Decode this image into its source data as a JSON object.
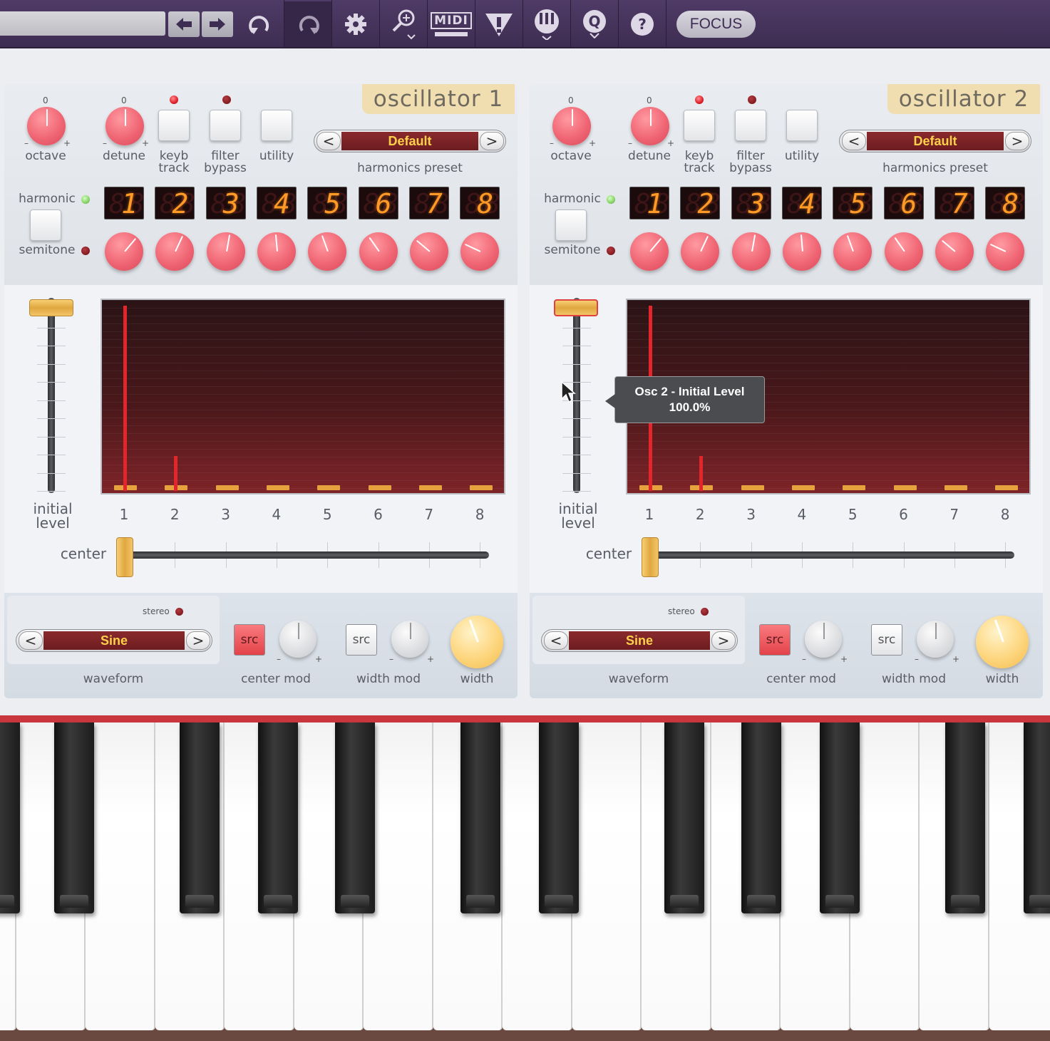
{
  "toolbar": {
    "icons": [
      "arrow-left-icon",
      "arrow-right-icon",
      "undo-icon",
      "redo-icon",
      "gear-icon",
      "zoom-icon",
      "midi-icon",
      "warning-icon",
      "keyboard-icon",
      "quantize-icon",
      "help-icon"
    ],
    "midi_label": "MIDI",
    "q_label": "Q",
    "help_label": "?",
    "focus_label": "FOCUS"
  },
  "osc1": {
    "title": "oscillator 1",
    "octave_label": "octave",
    "octave_zero": "0",
    "detune_label": "detune",
    "detune_zero": "0",
    "keybtrack_label": "keyb\ntrack",
    "filterbypass_label": "filter\nbypass",
    "utility_label": "utility",
    "preset_prev": "<",
    "preset_value": "Default",
    "preset_next": ">",
    "preset_label": "harmonics preset",
    "harmonic_label": "harmonic",
    "semitone_label": "semitone",
    "digits": [
      "1",
      "2",
      "3",
      "4",
      "5",
      "6",
      "7",
      "8"
    ],
    "initial_level_label": "initial\nlevel",
    "axis": [
      "1",
      "2",
      "3",
      "4",
      "5",
      "6",
      "7",
      "8"
    ],
    "center_label": "center",
    "stereo_label": "stereo",
    "waveform_prev": "<",
    "waveform_value": "Sine",
    "waveform_next": ">",
    "waveform_label": "waveform",
    "src_label": "src",
    "center_mod_label": "center mod",
    "width_mod_label": "width mod",
    "width_label": "width",
    "harmonic_levels": [
      1.0,
      0.19,
      0,
      0,
      0,
      0,
      0,
      0
    ]
  },
  "osc2": {
    "title": "oscillator 2",
    "octave_label": "octave",
    "octave_zero": "0",
    "detune_label": "detune",
    "detune_zero": "0",
    "keybtrack_label": "keyb\ntrack",
    "filterbypass_label": "filter\nbypass",
    "utility_label": "utility",
    "preset_prev": "<",
    "preset_value": "Default",
    "preset_next": ">",
    "preset_label": "harmonics preset",
    "harmonic_label": "harmonic",
    "semitone_label": "semitone",
    "digits": [
      "1",
      "2",
      "3",
      "4",
      "5",
      "6",
      "7",
      "8"
    ],
    "initial_level_label": "initial\nlevel",
    "axis": [
      "1",
      "2",
      "3",
      "4",
      "5",
      "6",
      "7",
      "8"
    ],
    "center_label": "center",
    "stereo_label": "stereo",
    "waveform_prev": "<",
    "waveform_value": "Sine",
    "waveform_next": ">",
    "waveform_label": "waveform",
    "src_label": "src",
    "center_mod_label": "center mod",
    "width_mod_label": "width mod",
    "width_label": "width",
    "harmonic_levels": [
      1.0,
      0.19,
      0,
      0,
      0,
      0,
      0,
      0
    ]
  },
  "tooltip": {
    "line1": "Osc 2 - Initial Level",
    "line2": "100.0%"
  },
  "colors": {
    "toolbar": "#45325a",
    "accent_red": "#f06674",
    "accent_yellow": "#f3bb4a",
    "display_bg": "#4a181b"
  }
}
